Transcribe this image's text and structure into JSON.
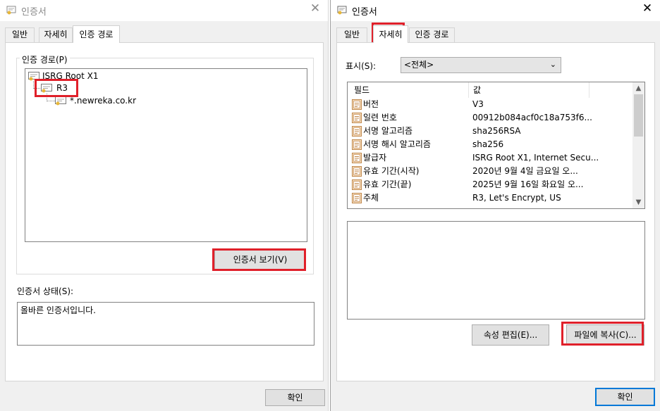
{
  "left_window": {
    "title": "인증서",
    "close_glyph": "✕",
    "tabs": [
      {
        "label": "일반"
      },
      {
        "label": "자세히"
      },
      {
        "label": "인증 경로"
      }
    ],
    "path_group_label": "인증 경로(P)",
    "tree": [
      {
        "label": "ISRG Root X1"
      },
      {
        "label": "R3"
      },
      {
        "label": "*.newreka.co.kr"
      }
    ],
    "view_cert_button": "인증서 보기(V)",
    "status_label": "인증서 상태(S):",
    "status_text": "올바른 인증서입니다.",
    "ok_button": "확인"
  },
  "right_window": {
    "title": "인증서",
    "close_glyph": "✕",
    "tabs": [
      {
        "label": "일반"
      },
      {
        "label": "자세히"
      },
      {
        "label": "인증 경로"
      }
    ],
    "show_label": "표시(S):",
    "show_value": "<전체>",
    "columns": {
      "field": "필드",
      "value": "값"
    },
    "rows": [
      {
        "field": "버전",
        "value": "V3"
      },
      {
        "field": "일련 번호",
        "value": "00912b084acf0c18a753f6..."
      },
      {
        "field": "서명 알고리즘",
        "value": "sha256RSA"
      },
      {
        "field": "서명 해시 알고리즘",
        "value": "sha256"
      },
      {
        "field": "발급자",
        "value": "ISRG Root X1, Internet Secu..."
      },
      {
        "field": "유효 기간(시작)",
        "value": "2020년 9월 4일 금요일 오..."
      },
      {
        "field": "유효 기간(끝)",
        "value": "2025년 9월 16일 화요일 오..."
      },
      {
        "field": "주체",
        "value": "R3, Let's Encrypt, US"
      }
    ],
    "edit_properties_button": "속성 편집(E)...",
    "copy_to_file_button": "파일에 복사(C)...",
    "ok_button": "확인"
  },
  "colors": {
    "highlight": "#e0202a",
    "focus_border": "#0078d7",
    "dialog_bg": "#f0f0f0"
  }
}
